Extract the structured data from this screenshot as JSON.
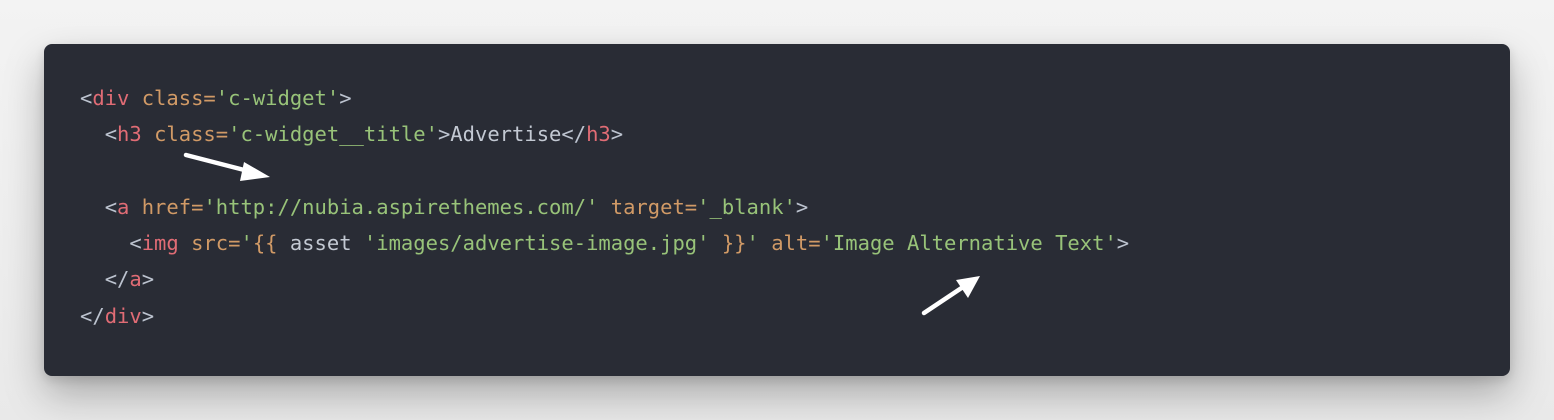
{
  "code": {
    "line1": {
      "lt": "<",
      "tag": "div",
      "attr1_name": "class=",
      "attr1_value": "'c-widget'",
      "gt": ">"
    },
    "line2": {
      "indent": "  ",
      "lt": "<",
      "tag": "h3",
      "attr1_name": "class=",
      "attr1_value": "'c-widget__title'",
      "gt": ">",
      "text": "Advertise",
      "close_lt": "</",
      "close_tag": "h3",
      "close_gt": ">"
    },
    "line4": {
      "indent": "  ",
      "lt": "<",
      "tag": "a",
      "attr1_name": "href=",
      "attr1_value": "'http://nubia.aspirethemes.com/'",
      "attr2_name": "target=",
      "attr2_value": "'_blank'",
      "gt": ">"
    },
    "line5": {
      "indent": "    ",
      "lt": "<",
      "tag": "img",
      "attr1_name": "src=",
      "attr1_value_open": "'",
      "braces_open": "{{",
      "helper": " asset ",
      "helper_arg": "'images/advertise-image.jpg'",
      "braces_close": " }}",
      "attr1_value_close": "'",
      "attr2_name": "alt=",
      "attr2_value": "'Image Alternative Text'",
      "gt": ">"
    },
    "line6": {
      "indent": "  ",
      "close_lt": "</",
      "close_tag": "a",
      "close_gt": ">"
    },
    "line7": {
      "close_lt": "</",
      "close_tag": "div",
      "close_gt": ">"
    }
  },
  "colors": {
    "card_background": "#292c35",
    "tag": "#e06c75",
    "attribute": "#d19a66",
    "string": "#98c379",
    "punctuation": "#bcc3cf",
    "arrow": "#ffffff"
  },
  "annotations": [
    {
      "icon": "arrow-icon",
      "points_to": "line3-blank-line"
    },
    {
      "icon": "arrow-icon",
      "points_to": "line5-alt-attribute"
    }
  ]
}
